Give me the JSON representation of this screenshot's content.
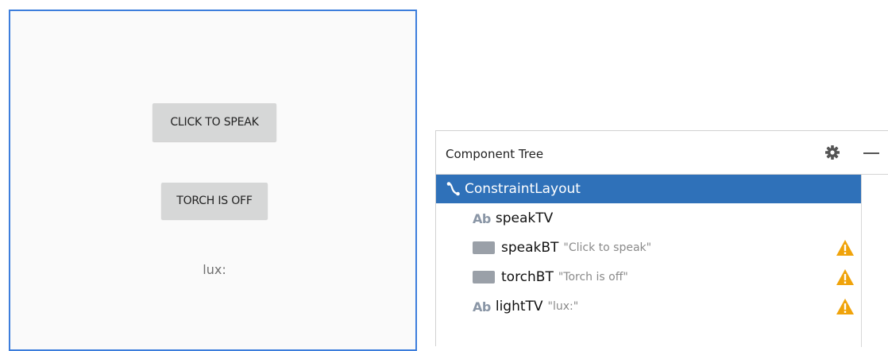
{
  "preview": {
    "speak_button": "CLICK TO SPEAK",
    "torch_button": "TORCH IS OFF",
    "lux_text": "lux:"
  },
  "panel": {
    "title": "Component Tree",
    "settings_icon": "gear-icon",
    "minimize_icon": "minimize-icon"
  },
  "tree": [
    {
      "name": "ConstraintLayout",
      "kind": "layout",
      "icon": "constraint-layout-icon",
      "desc": "",
      "warning": false,
      "selected": true
    },
    {
      "name": "speakTV",
      "kind": "textview",
      "icon": "textview-icon",
      "desc": "",
      "warning": false,
      "selected": false
    },
    {
      "name": "speakBT",
      "kind": "button",
      "icon": "button-icon",
      "desc": "\"Click to speak\"",
      "warning": true,
      "selected": false
    },
    {
      "name": "torchBT",
      "kind": "button",
      "icon": "button-icon",
      "desc": "\"Torch is off\"",
      "warning": true,
      "selected": false
    },
    {
      "name": "lightTV",
      "kind": "textview",
      "icon": "textview-icon",
      "desc": "\"lux:\"",
      "warning": true,
      "selected": false
    }
  ],
  "tree_icon_text": {
    "textview": "Ab"
  },
  "colors": {
    "selection": "#2f71b9",
    "preview_border": "#3d7edc",
    "warning": "#f0a30a"
  }
}
